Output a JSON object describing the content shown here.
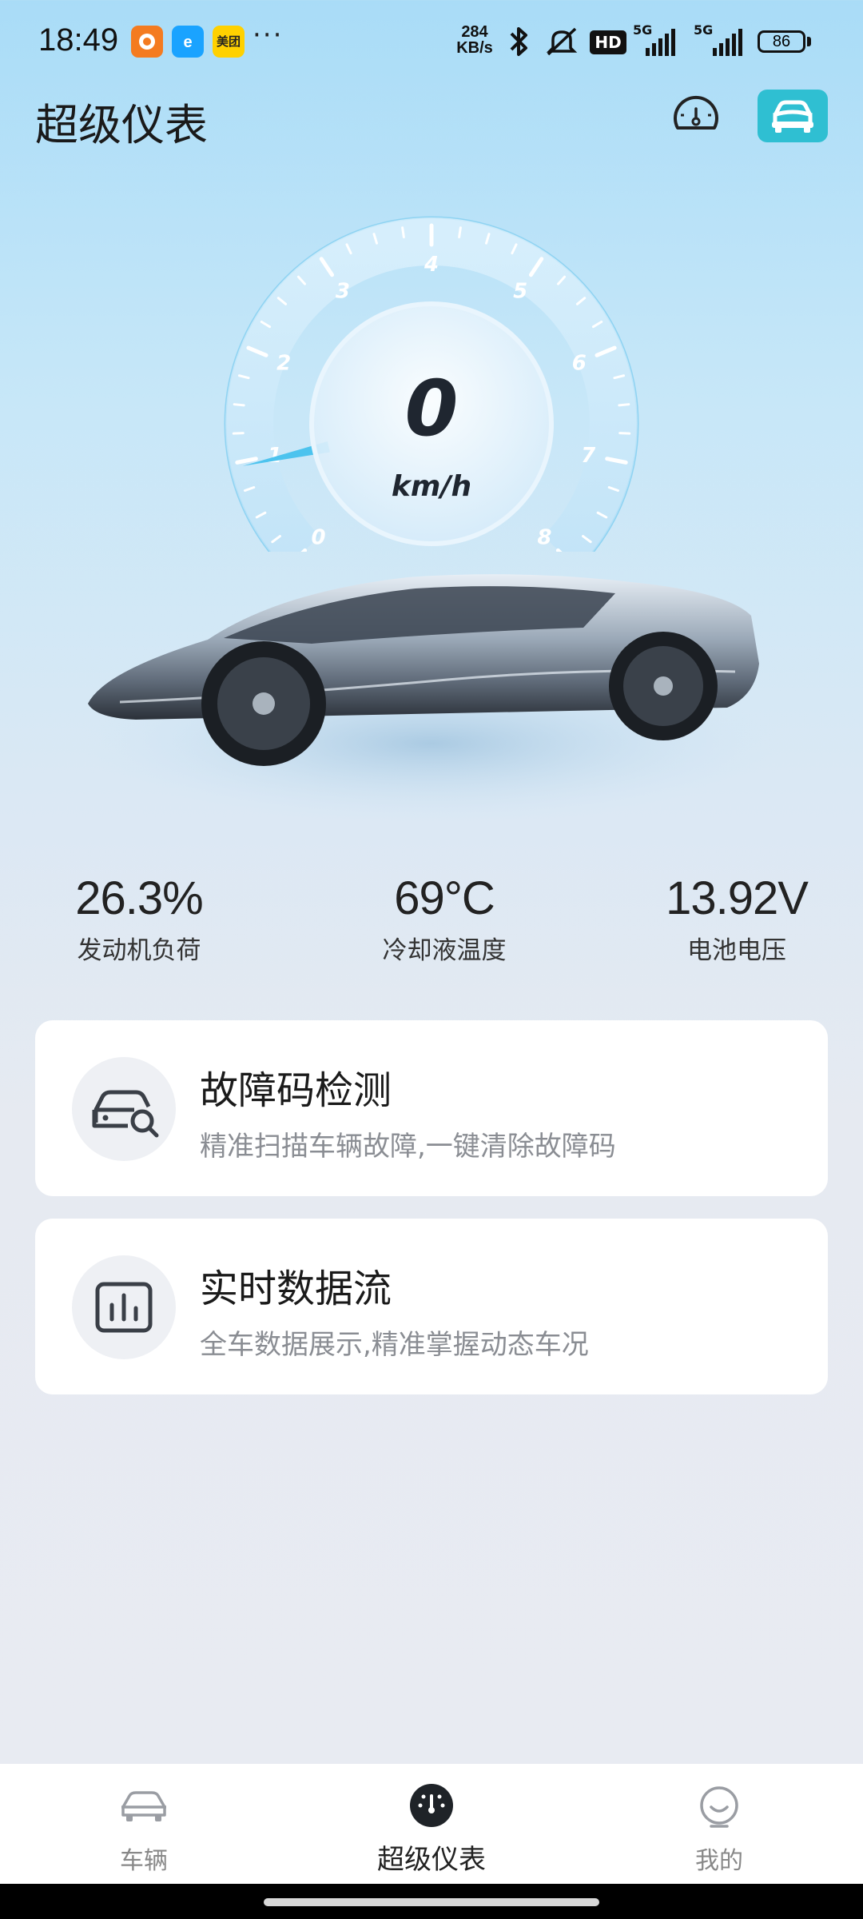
{
  "status": {
    "time": "18:49",
    "net_speed_value": "284",
    "net_speed_unit": "KB/s",
    "battery": "86",
    "app_badge_meituan": "美团",
    "more": "···",
    "hd_label": "HD",
    "network_1": "5G",
    "network_2": "5G"
  },
  "header": {
    "title": "超级仪表"
  },
  "gauge": {
    "speed": "0",
    "unit": "km/h",
    "ticks": [
      "0",
      "1",
      "2",
      "3",
      "4",
      "5",
      "6",
      "7",
      "8"
    ],
    "accent_color": "#4cc3ee"
  },
  "metrics": [
    {
      "value": "26.3%",
      "label": "发动机负荷"
    },
    {
      "value": "69°C",
      "label": "冷却液温度"
    },
    {
      "value": "13.92V",
      "label": "电池电压"
    }
  ],
  "cards": [
    {
      "title": "故障码检测",
      "subtitle": "精准扫描车辆故障,一键清除故障码",
      "icon": "car-search-icon"
    },
    {
      "title": "实时数据流",
      "subtitle": "全车数据展示,精准掌握动态车况",
      "icon": "bar-chart-icon"
    }
  ],
  "nav": [
    {
      "label": "车辆",
      "icon": "car-icon",
      "active": false
    },
    {
      "label": "超级仪表",
      "icon": "speedometer-icon",
      "active": true
    },
    {
      "label": "我的",
      "icon": "profile-icon",
      "active": false
    }
  ],
  "colors": {
    "accent": "#2fbfd2",
    "gauge": "#4cc3ee"
  }
}
